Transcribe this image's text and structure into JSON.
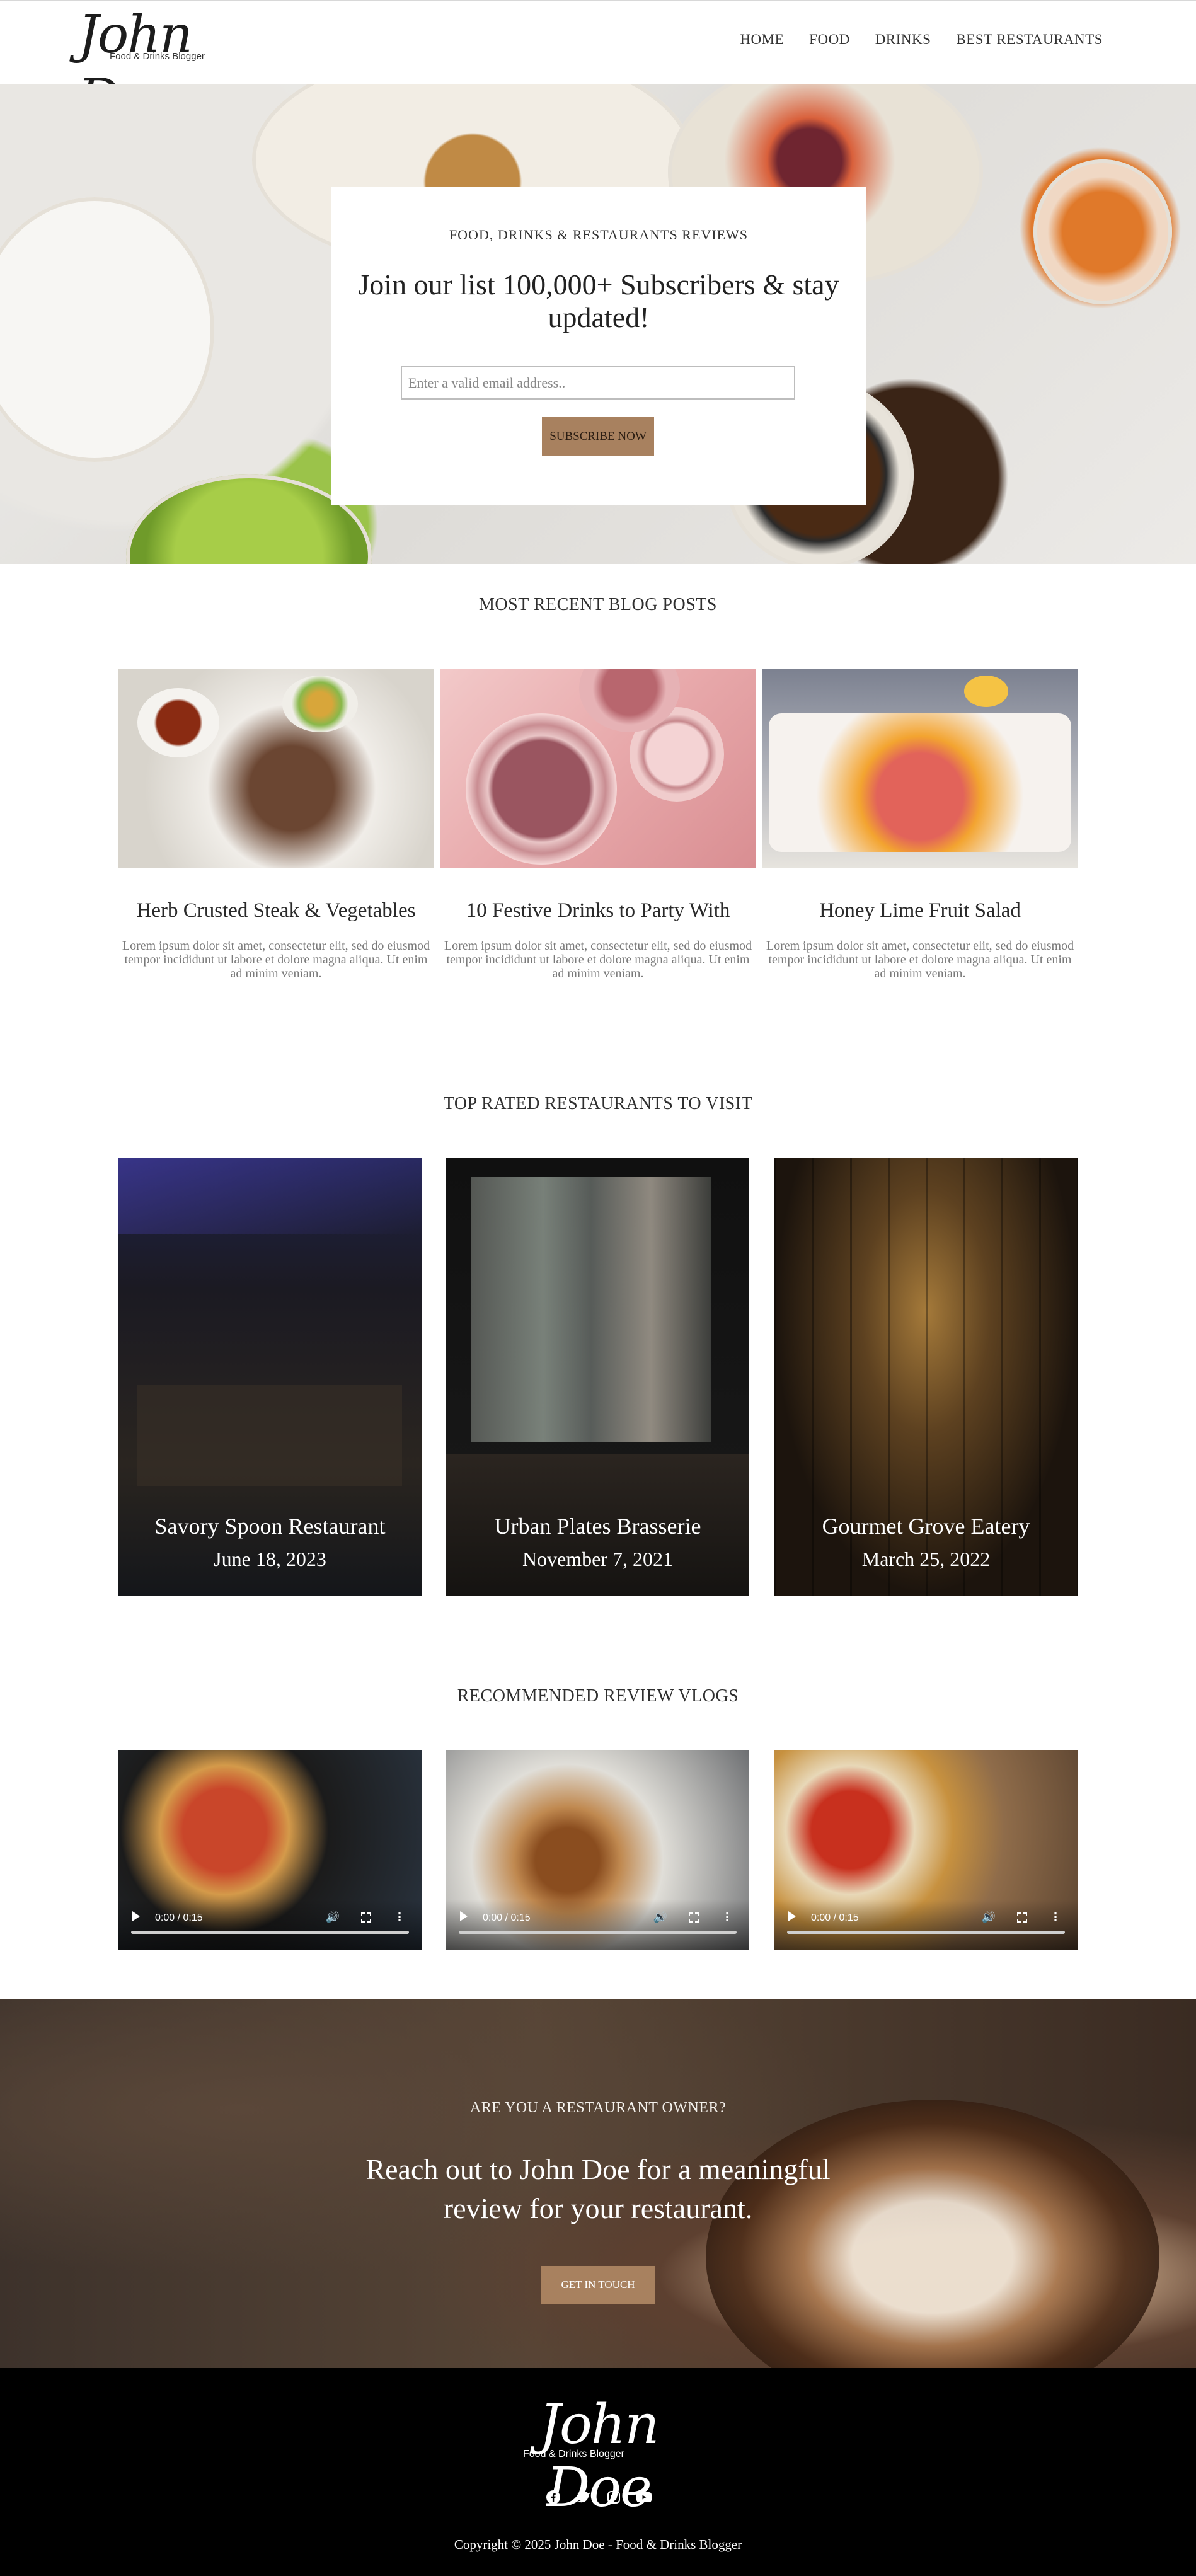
{
  "header": {
    "logo_name": "John Doe",
    "logo_tagline": "Food & Drinks Blogger",
    "nav": [
      "HOME",
      "FOOD",
      "DRINKS",
      "BEST RESTAURANTS"
    ]
  },
  "hero": {
    "kicker": "FOOD, DRINKS & RESTAURANTS REVIEWS",
    "title": "Join our list 100,000+ Subscribers & stay updated!",
    "email_placeholder": "Enter a valid email address..",
    "subscribe_label": "SUBSCRIBE NOW"
  },
  "recent_posts": {
    "title": "MOST RECENT BLOG POSTS",
    "posts": [
      {
        "title": "Herb Crusted Steak & Vegetables",
        "excerpt": "Lorem ipsum dolor sit amet, consectetur elit, sed do eiusmod tempor incididunt ut labore et dolore magna aliqua. Ut enim ad minim veniam."
      },
      {
        "title": "10 Festive Drinks to Party With",
        "excerpt": "Lorem ipsum dolor sit amet, consectetur elit, sed do eiusmod tempor incididunt ut labore et dolore magna aliqua. Ut enim ad minim veniam."
      },
      {
        "title": "Honey Lime Fruit Salad",
        "excerpt": "Lorem ipsum dolor sit amet, consectetur elit, sed do eiusmod tempor incididunt ut labore et dolore magna aliqua. Ut enim ad minim veniam."
      }
    ]
  },
  "restaurants": {
    "title": "TOP RATED RESTAURANTS TO VISIT",
    "items": [
      {
        "name": "Savory Spoon Restaurant",
        "date": "June 18, 2023"
      },
      {
        "name": "Urban Plates Brasserie",
        "date": "November 7, 2021"
      },
      {
        "name": "Gourmet Grove Eatery",
        "date": "March 25, 2022"
      }
    ]
  },
  "vlogs": {
    "title": "RECOMMENDED REVIEW VLOGS",
    "items": [
      {
        "time": "0:00 / 0:15"
      },
      {
        "time": "0:00 / 0:15"
      },
      {
        "time": "0:00 / 0:15"
      }
    ]
  },
  "cta": {
    "kicker": "ARE YOU A RESTAURANT OWNER?",
    "title": "Reach out to John Doe for a meaningful review for your restaurant.",
    "button_label": "GET IN TOUCH"
  },
  "footer": {
    "logo_name": "John Doe",
    "logo_tagline": "Food & Drinks Blogger",
    "socials": [
      "facebook-icon",
      "twitter-icon",
      "instagram-icon",
      "youtube-icon"
    ],
    "copyright": "Copyright © 2025 John Doe - Food & Drinks Blogger"
  },
  "colors": {
    "accent": "#a8815f",
    "footer_bg": "#000000"
  }
}
